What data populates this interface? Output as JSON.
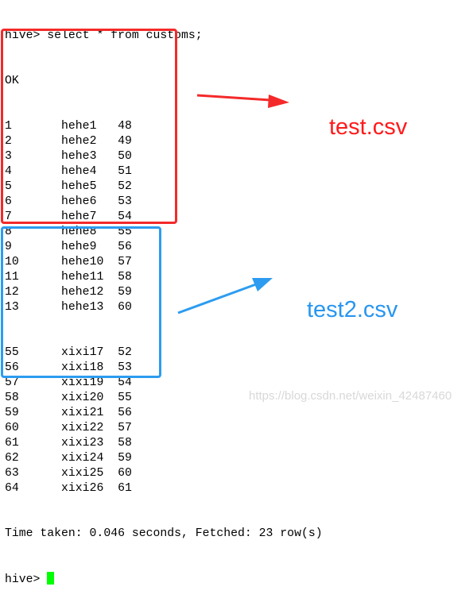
{
  "terminal": {
    "prompt": "hive>",
    "command": "select * from customs;",
    "status": "OK",
    "rows_group1": [
      [
        "1",
        "hehe1",
        "48"
      ],
      [
        "2",
        "hehe2",
        "49"
      ],
      [
        "3",
        "hehe3",
        "50"
      ],
      [
        "4",
        "hehe4",
        "51"
      ],
      [
        "5",
        "hehe5",
        "52"
      ],
      [
        "6",
        "hehe6",
        "53"
      ],
      [
        "7",
        "hehe7",
        "54"
      ],
      [
        "8",
        "hehe8",
        "55"
      ],
      [
        "9",
        "hehe9",
        "56"
      ],
      [
        "10",
        "hehe10",
        "57"
      ],
      [
        "11",
        "hehe11",
        "58"
      ],
      [
        "12",
        "hehe12",
        "59"
      ],
      [
        "13",
        "hehe13",
        "60"
      ]
    ],
    "rows_group2": [
      [
        "55",
        "xixi17",
        "52"
      ],
      [
        "56",
        "xixi18",
        "53"
      ],
      [
        "57",
        "xixi19",
        "54"
      ],
      [
        "58",
        "xixi20",
        "55"
      ],
      [
        "59",
        "xixi21",
        "56"
      ],
      [
        "60",
        "xixi22",
        "57"
      ],
      [
        "61",
        "xixi23",
        "58"
      ],
      [
        "62",
        "xixi24",
        "59"
      ],
      [
        "63",
        "xixi25",
        "60"
      ],
      [
        "64",
        "xixi26",
        "61"
      ]
    ],
    "summary": "Time taken: 0.046 seconds, Fetched: 23 row(s)",
    "cursor_color": "#00ff00"
  },
  "annotations": {
    "label1": "test.csv",
    "label1_color": "#ff1a1a",
    "label2": "test2.csv",
    "label2_color": "#2896f0"
  },
  "watermark": "https://blog.csdn.net/weixin_42487460"
}
